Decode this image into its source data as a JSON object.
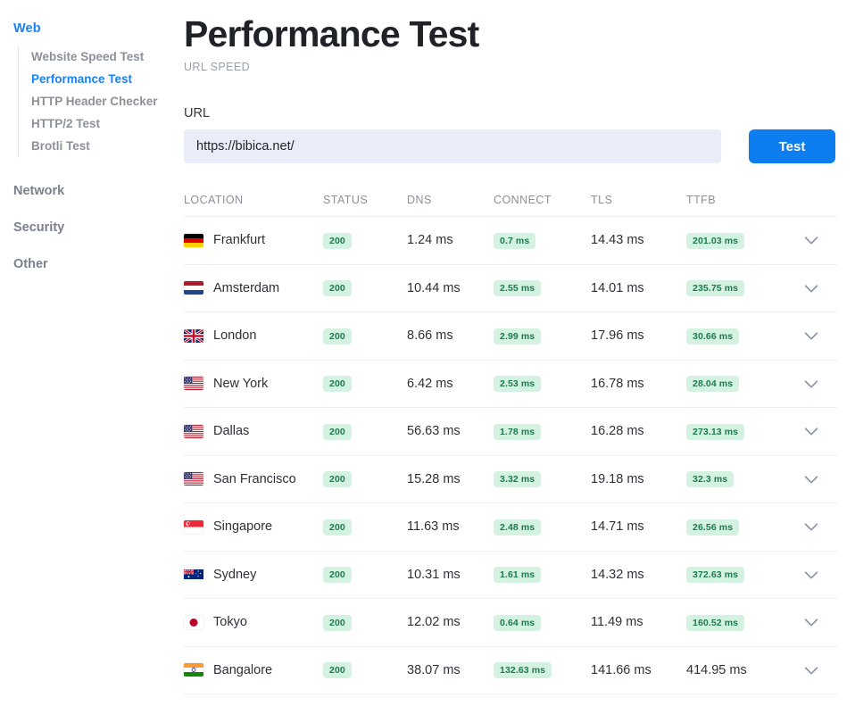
{
  "sidebar": {
    "groups": [
      {
        "label": "Web",
        "active": true,
        "items": [
          {
            "label": "Website Speed Test",
            "active": false
          },
          {
            "label": "Performance Test",
            "active": true
          },
          {
            "label": "HTTP Header Checker",
            "active": false
          },
          {
            "label": "HTTP/2 Test",
            "active": false
          },
          {
            "label": "Brotli Test",
            "active": false
          }
        ]
      }
    ],
    "top_items": [
      {
        "label": "Network"
      },
      {
        "label": "Security"
      },
      {
        "label": "Other"
      }
    ]
  },
  "header": {
    "title": "Performance Test",
    "subtitle": "URL SPEED"
  },
  "form": {
    "url_label": "URL",
    "url_value": "https://bibica.net/",
    "url_placeholder": "https://bibica.net/",
    "test_label": "Test"
  },
  "table": {
    "columns": [
      "LOCATION",
      "STATUS",
      "DNS",
      "CONNECT",
      "TLS",
      "TTFB"
    ],
    "rows": [
      {
        "location": "Frankfurt",
        "flag": "de",
        "status": "200",
        "dns": "1.24 ms",
        "connect": "0.7 ms",
        "tls": "14.43 ms",
        "ttfb": "201.03 ms",
        "connect_badge": true,
        "ttfb_badge": true
      },
      {
        "location": "Amsterdam",
        "flag": "nl",
        "status": "200",
        "dns": "10.44 ms",
        "connect": "2.55 ms",
        "tls": "14.01 ms",
        "ttfb": "235.75 ms",
        "connect_badge": true,
        "ttfb_badge": true
      },
      {
        "location": "London",
        "flag": "gb",
        "status": "200",
        "dns": "8.66 ms",
        "connect": "2.99 ms",
        "tls": "17.96 ms",
        "ttfb": "30.66 ms",
        "connect_badge": true,
        "ttfb_badge": true
      },
      {
        "location": "New York",
        "flag": "us",
        "status": "200",
        "dns": "6.42 ms",
        "connect": "2.53 ms",
        "tls": "16.78 ms",
        "ttfb": "28.04 ms",
        "connect_badge": true,
        "ttfb_badge": true
      },
      {
        "location": "Dallas",
        "flag": "us",
        "status": "200",
        "dns": "56.63 ms",
        "connect": "1.78 ms",
        "tls": "16.28 ms",
        "ttfb": "273.13 ms",
        "connect_badge": true,
        "ttfb_badge": true
      },
      {
        "location": "San Francisco",
        "flag": "us",
        "status": "200",
        "dns": "15.28 ms",
        "connect": "3.32 ms",
        "tls": "19.18 ms",
        "ttfb": "32.3 ms",
        "connect_badge": true,
        "ttfb_badge": true
      },
      {
        "location": "Singapore",
        "flag": "sg",
        "status": "200",
        "dns": "11.63 ms",
        "connect": "2.48 ms",
        "tls": "14.71 ms",
        "ttfb": "26.56 ms",
        "connect_badge": true,
        "ttfb_badge": true
      },
      {
        "location": "Sydney",
        "flag": "au",
        "status": "200",
        "dns": "10.31 ms",
        "connect": "1.61 ms",
        "tls": "14.32 ms",
        "ttfb": "372.63 ms",
        "connect_badge": true,
        "ttfb_badge": true
      },
      {
        "location": "Tokyo",
        "flag": "jp",
        "status": "200",
        "dns": "12.02 ms",
        "connect": "0.64 ms",
        "tls": "11.49 ms",
        "ttfb": "160.52 ms",
        "connect_badge": true,
        "ttfb_badge": true
      },
      {
        "location": "Bangalore",
        "flag": "in",
        "status": "200",
        "dns": "38.07 ms",
        "connect": "132.63 ms",
        "tls": "141.66 ms",
        "ttfb": "414.95 ms",
        "connect_badge": true,
        "ttfb_badge": false
      }
    ],
    "expand_icon": "chevron-down-icon"
  },
  "colors": {
    "accent_blue": "#1a82f7",
    "button_blue": "#0d7ef0",
    "badge_bg": "#d4f2e1",
    "badge_text": "#1d7a4c",
    "input_bg": "#e9edf8",
    "muted_text": "#8a919b"
  }
}
